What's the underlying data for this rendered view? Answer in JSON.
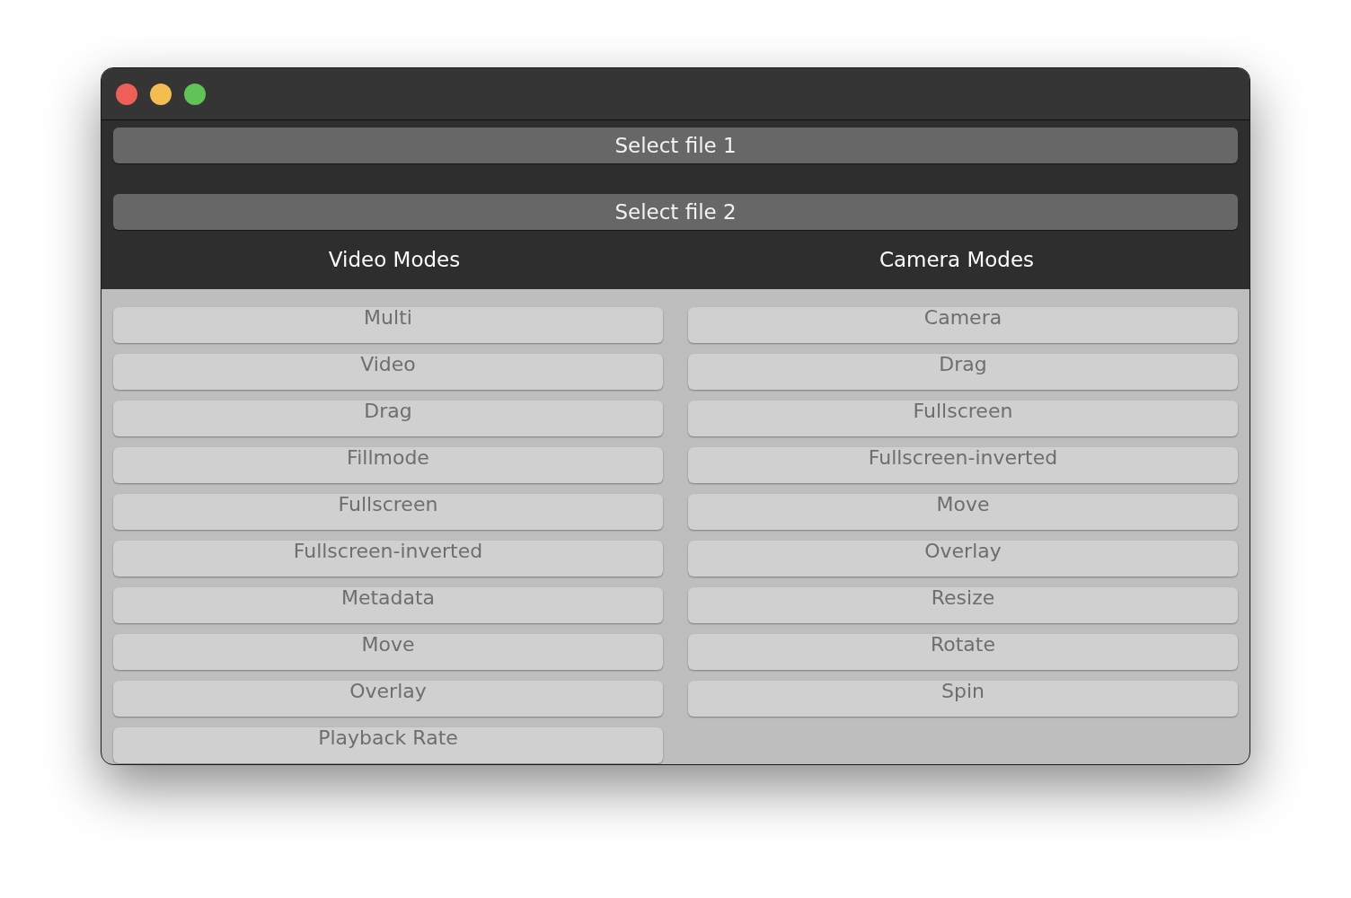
{
  "file_buttons": [
    "Select file 1",
    "Select file 2"
  ],
  "columns": [
    {
      "title": "Video Modes",
      "buttons": [
        "Multi",
        "Video",
        "Drag",
        "Fillmode",
        "Fullscreen",
        "Fullscreen-inverted",
        "Metadata",
        "Move",
        "Overlay",
        "Playback Rate"
      ]
    },
    {
      "title": "Camera Modes",
      "buttons": [
        "Camera",
        "Drag",
        "Fullscreen",
        "Fullscreen-inverted",
        "Move",
        "Overlay",
        "Resize",
        "Rotate",
        "Spin"
      ]
    }
  ]
}
